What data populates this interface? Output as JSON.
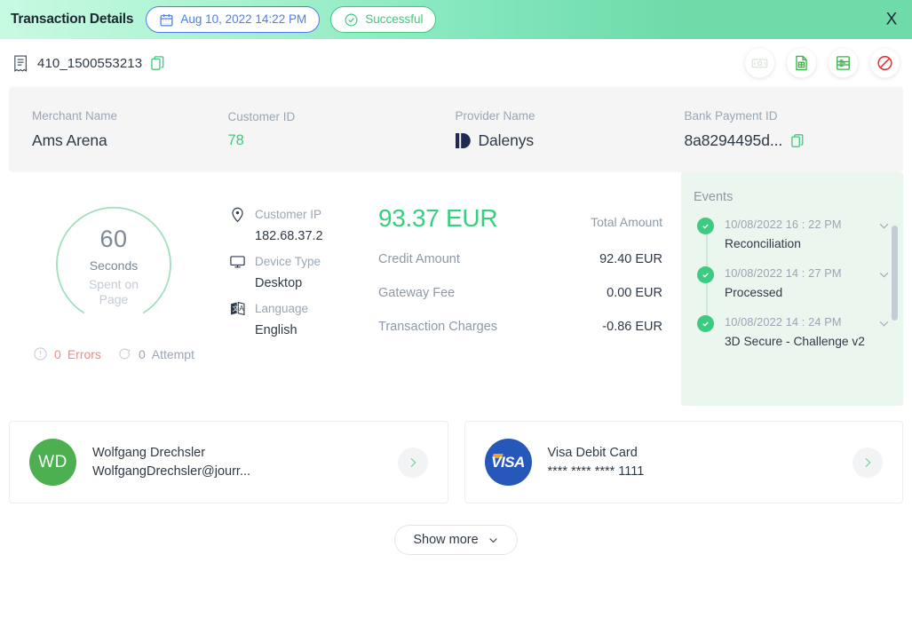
{
  "header": {
    "title": "Transaction Details",
    "date_pill": {
      "icon": "calendar-icon",
      "label": "Aug 10, 2022 14:22 PM",
      "color": "#4a7ef0"
    },
    "status_pill": {
      "icon": "check-circle-icon",
      "label": "Successful",
      "color": "#3ccb7f"
    },
    "close_label": "X",
    "gradient_from": "#c8fae2",
    "gradient_to": "#6edba9"
  },
  "transaction": {
    "icon": "receipt-icon",
    "id": "410_1500553213",
    "copy_icon": "copy-icon",
    "actions": [
      {
        "name": "cash-icon",
        "title": "Cash",
        "disabled": true
      },
      {
        "name": "invoice-icon",
        "title": "Invoice",
        "disabled": false
      },
      {
        "name": "ledger-icon",
        "title": "Ledger",
        "disabled": false
      },
      {
        "name": "block-icon",
        "title": "Block",
        "disabled": false
      }
    ]
  },
  "info_strip": [
    {
      "label": "Merchant Name",
      "value": "Ams Arena",
      "style": "dark"
    },
    {
      "label": "Customer ID",
      "value": "78",
      "style": "green"
    },
    {
      "label": "Provider Name",
      "value": "Dalenys",
      "style": "dark",
      "logo": "dalenys-logo"
    },
    {
      "label": "Bank Payment ID",
      "value": "8a8294495d...",
      "style": "dark",
      "copy_icon": "copy-icon"
    }
  ],
  "timer": {
    "value": "60",
    "unit": "Seconds",
    "caption": "Spent on Page",
    "ring_color": "#9fe0bd",
    "errors": {
      "count": "0",
      "label": "Errors",
      "icon": "alert-circle-icon",
      "color": "#f28a86"
    },
    "attempts": {
      "count": "0",
      "label": "Attempt",
      "icon": "retry-icon"
    }
  },
  "customer_meta": [
    {
      "icon": "location-pin-icon",
      "label": "Customer IP",
      "value": "182.68.37.2"
    },
    {
      "icon": "monitor-icon",
      "label": "Device Type",
      "value": "Desktop"
    },
    {
      "icon": "translate-icon",
      "label": "Language",
      "value": "English"
    }
  ],
  "amounts": {
    "total_value": "93.37 EUR",
    "total_label": "Total Amount",
    "rows": [
      {
        "label": "Credit Amount",
        "value": "92.40 EUR"
      },
      {
        "label": "Gateway Fee",
        "value": "0.00 EUR"
      },
      {
        "label": "Transaction Charges",
        "value": "-0.86 EUR"
      }
    ]
  },
  "events": {
    "title": "Events",
    "items": [
      {
        "time": "10/08/2022 16 : 22 PM",
        "name": "Reconciliation",
        "status_icon": "check-circle-icon",
        "chevron": "chevron-down-icon"
      },
      {
        "time": "10/08/2022 14 : 27 PM",
        "name": "Processed",
        "status_icon": "check-circle-icon",
        "chevron": "chevron-down-icon"
      },
      {
        "time": "10/08/2022 14 : 24 PM",
        "name": "3D Secure - Challenge v2",
        "status_icon": "check-circle-icon",
        "chevron": "chevron-down-icon"
      }
    ]
  },
  "bottom_cards": {
    "customer": {
      "avatar_initials": "WD",
      "avatar_color": "#4caf50",
      "line1": "Wolfgang Drechsler",
      "line2": "WolfgangDrechsler@jourr...",
      "arrow_icon": "chevron-right-icon"
    },
    "payment": {
      "brand_icon": "visa-logo",
      "brand_text": "VISA",
      "line1": "Visa Debit Card",
      "line2": "**** **** **** 1111",
      "arrow_icon": "chevron-right-icon"
    }
  },
  "footer": {
    "show_more_label": "Show more",
    "show_more_icon": "chevron-down-icon"
  }
}
